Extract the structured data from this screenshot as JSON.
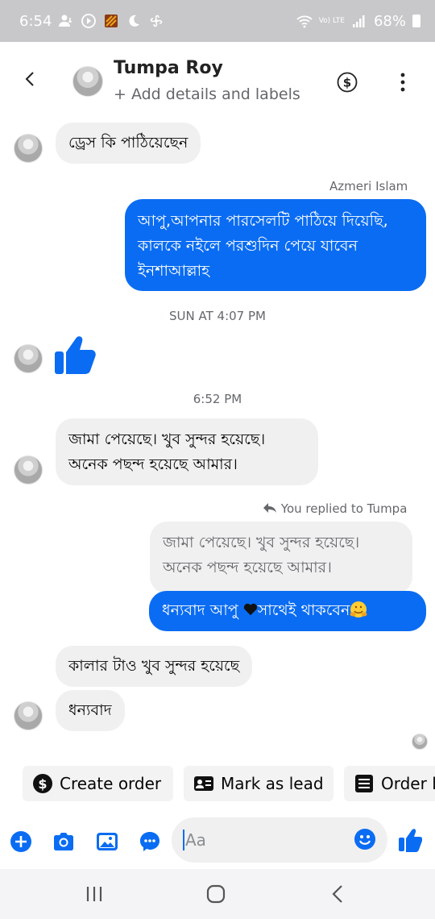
{
  "status_bar": {
    "time": "6:54",
    "battery": "68%",
    "lte_tag": "Vo) LTE"
  },
  "header": {
    "name": "Tumpa Roy",
    "subtitle": "+ Add details and labels"
  },
  "messages": {
    "m1": "ড্রেস কি পাঠিয়েছেন",
    "sender_label": "Azmeri Islam",
    "m2": "আপু,আপনার পারসেলটি পাঠিয়ে দিয়েছি, কালকে নইলে পরশুদিন পেয়ে যাবেন ইনশাআল্লাহ",
    "time1": "SUN AT 4:07 PM",
    "time2": "6:52 PM",
    "m3": "জামা পেয়েছে। খুব সুন্দর হয়েছে। অনেক পছন্দ হয়েছে আমার।",
    "replied_label": "You replied to Tumpa",
    "quoted": "জামা পেয়েছে। খুব সুন্দর হয়েছে। অনেক পছন্দ হয়েছে আমার।",
    "m4_a": "ধন্যবাদ আপু ",
    "m4_b": "সাথেই থাকবেন",
    "m5": "কালার টাও খুব সুন্দর হয়েছে",
    "m6": "ধন্যবাদ"
  },
  "quick_actions": {
    "create_order": "Create order",
    "mark_as_lead": "Mark as lead",
    "order": "Order l"
  },
  "composer": {
    "placeholder": "Aa"
  },
  "colors": {
    "accent": "#0a6cf2",
    "bubble_in": "#f0f0f0",
    "status_bar": "#c8c8ca"
  }
}
